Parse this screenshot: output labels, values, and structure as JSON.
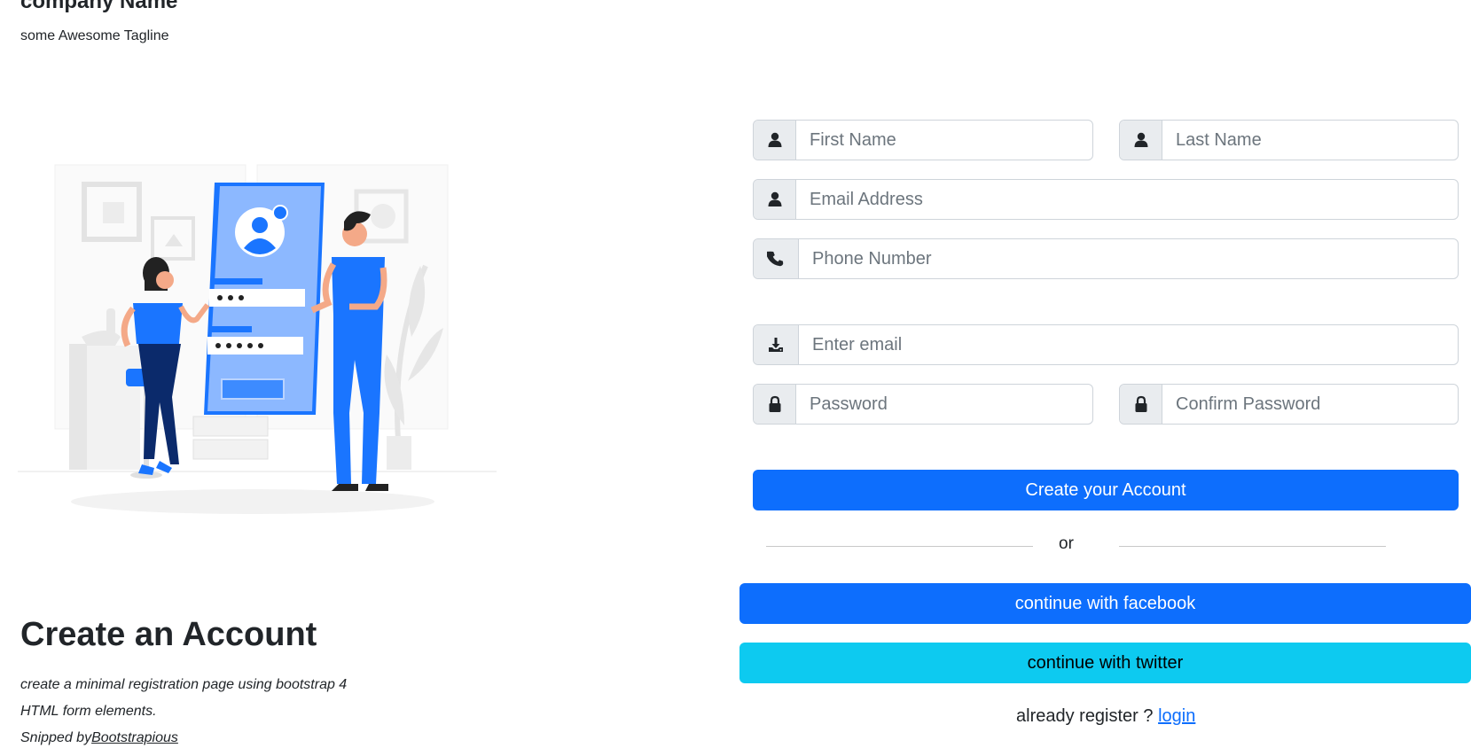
{
  "brand": {
    "name": "company Name",
    "tagline": "some Awesome Tagline"
  },
  "hero": {
    "title": "Create an Account",
    "line1": "create a minimal registration page using bootstrap 4",
    "line2": "HTML form elements.",
    "credit_prefix": "Snipped by",
    "credit_link": "Bootstrapious"
  },
  "form": {
    "first_name": {
      "placeholder": "First Name",
      "icon": "user-icon"
    },
    "last_name": {
      "placeholder": "Last Name",
      "icon": "user-icon"
    },
    "email_address": {
      "placeholder": "Email Address",
      "icon": "user-icon"
    },
    "phone": {
      "placeholder": "Phone Number",
      "icon": "phone-icon"
    },
    "enter_email": {
      "placeholder": "Enter email",
      "icon": "download-icon"
    },
    "password": {
      "placeholder": "Password",
      "icon": "lock-icon"
    },
    "confirm_password": {
      "placeholder": "Confirm Password",
      "icon": "lock-icon"
    },
    "submit_label": "Create your Account",
    "divider_text": "or",
    "facebook_label": "continue with facebook",
    "twitter_label": "continue with twitter",
    "login_prompt": "already register ?",
    "login_link": "login"
  },
  "colors": {
    "primary": "#0d6efd",
    "info": "#0dcaf0",
    "addon_bg": "#e9ecef",
    "border": "#ced4da",
    "illustration_blue": "#1a75ff"
  }
}
